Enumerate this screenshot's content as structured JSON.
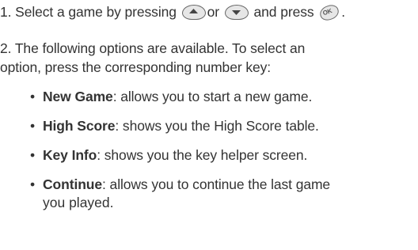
{
  "step1": {
    "prefix": "1. Select a game by pressing ",
    "up_icon": "up-nav-key-icon",
    "middle": "or ",
    "down_icon": "down-nav-key-icon",
    "and": " and press ",
    "ok_icon": "ok-key-icon",
    "ok_label": "OK",
    "suffix": "."
  },
  "step2": {
    "line1": "2. The following options are available. To select an",
    "line2": "option, press the corresponding number key:"
  },
  "options": [
    {
      "term": "New Game",
      "desc": ": allows you to start a new game."
    },
    {
      "term": "High Score",
      "desc": ": shows you the High Score table."
    },
    {
      "term": "Key Info",
      "desc": ": shows you the key helper screen."
    },
    {
      "term": "Continue",
      "desc": ": allows you to continue the last game",
      "desc2": "you played."
    }
  ],
  "bullet": "•"
}
